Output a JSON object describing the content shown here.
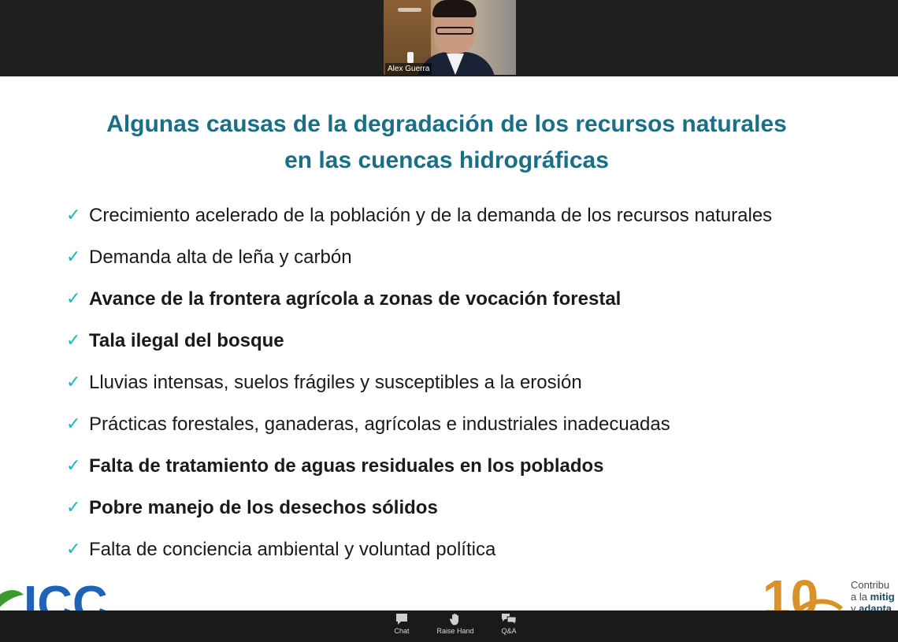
{
  "meeting": {
    "participant_name": "Alex Guerra"
  },
  "slide": {
    "title_line1": "Algunas causas de la degradación de los recursos naturales",
    "title_line2": "en las cuencas hidrográficas",
    "bullets": [
      {
        "text": "Crecimiento acelerado de la población y de la demanda de los recursos naturales",
        "bold": false
      },
      {
        "text": "Demanda alta de leña y carbón",
        "bold": false
      },
      {
        "text": "Avance de la frontera agrícola a zonas de vocación forestal",
        "bold": true
      },
      {
        "text": "Tala ilegal del bosque",
        "bold": true
      },
      {
        "text": "Lluvias intensas, suelos frágiles y susceptibles a la erosión",
        "bold": false
      },
      {
        "text": "Prácticas forestales, ganaderas, agrícolas e industriales inadecuadas",
        "bold": false
      },
      {
        "text": "Falta de tratamiento de aguas residuales en los poblados",
        "bold": true
      },
      {
        "text": "Pobre manejo de los desechos sólidos",
        "bold": true
      },
      {
        "text": "Falta de conciencia ambiental y voluntad política",
        "bold": false
      }
    ],
    "check_glyph": "✓",
    "logo_right": {
      "number": "10",
      "tag_line1": "Contribu",
      "tag_line2_prefix": "a la ",
      "tag_line2_bold": "mitig",
      "tag_line3_prefix": "y ",
      "tag_line3_bold": "adapta"
    },
    "logo_left": {
      "text": "ICC"
    }
  },
  "toolbar": {
    "items": [
      {
        "label": "Chat",
        "icon": "chat-icon"
      },
      {
        "label": "Raise Hand",
        "icon": "raise-hand-icon"
      },
      {
        "label": "Q&A",
        "icon": "qa-icon"
      }
    ]
  },
  "colors": {
    "title": "#1a6f86",
    "check": "#1cb3c8",
    "logo_orange": "#d9922a",
    "logo_blue": "#1e63b5",
    "logo_green": "#3d9a2f"
  }
}
